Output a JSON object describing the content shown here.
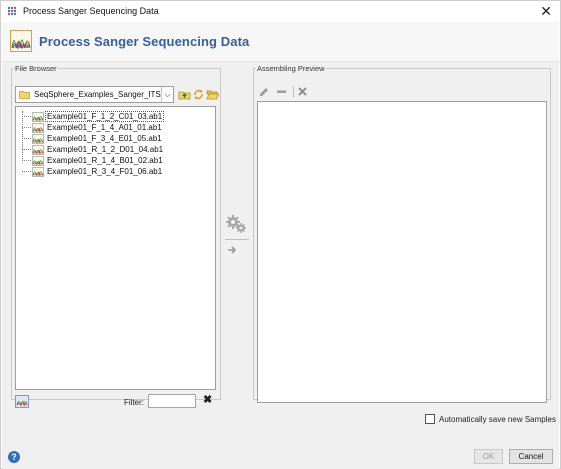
{
  "window": {
    "title": "Process Sanger Sequencing Data",
    "close_glyph": "✕",
    "app_icon": "seqsphere-app-icon"
  },
  "header": {
    "title": "Process Sanger Sequencing Data",
    "logo_icon": "chromatogram-icon",
    "title_color": "#3a5f96"
  },
  "file_browser": {
    "legend": "File Browser",
    "path": "SeqSphere_Examples_Sanger_ITS/",
    "dropdown_glyph": "⌵",
    "toolbar_icons": [
      "folder-up-icon",
      "refresh-icon",
      "open-folder-icon"
    ],
    "files": [
      "Example01_F_1_2_C01_03.ab1",
      "Example01_F_1_4_A01_01.ab1",
      "Example01_F_3_4_E01_05.ab1",
      "Example01_R_1_2_D01_04.ab1",
      "Example01_R_1_4_B01_02.ab1",
      "Example01_R_3_4_F01_06.ab1"
    ],
    "selected_index": 0,
    "filter_label": "Filter:",
    "filter_value": "",
    "filter_clear_glyph": "✖"
  },
  "transfer": {
    "process_icon": "gears-icon",
    "move_icon": "arrow-right-icon"
  },
  "assembling_preview": {
    "legend": "Assembling Preview",
    "toolbar_icons": [
      "edit-icon",
      "remove-icon",
      "delete-icon"
    ]
  },
  "footer": {
    "autosave_label": "Automatically save new Samples",
    "autosave_checked": false,
    "help_glyph": "?",
    "ok_label": "OK",
    "cancel_label": "Cancel"
  }
}
